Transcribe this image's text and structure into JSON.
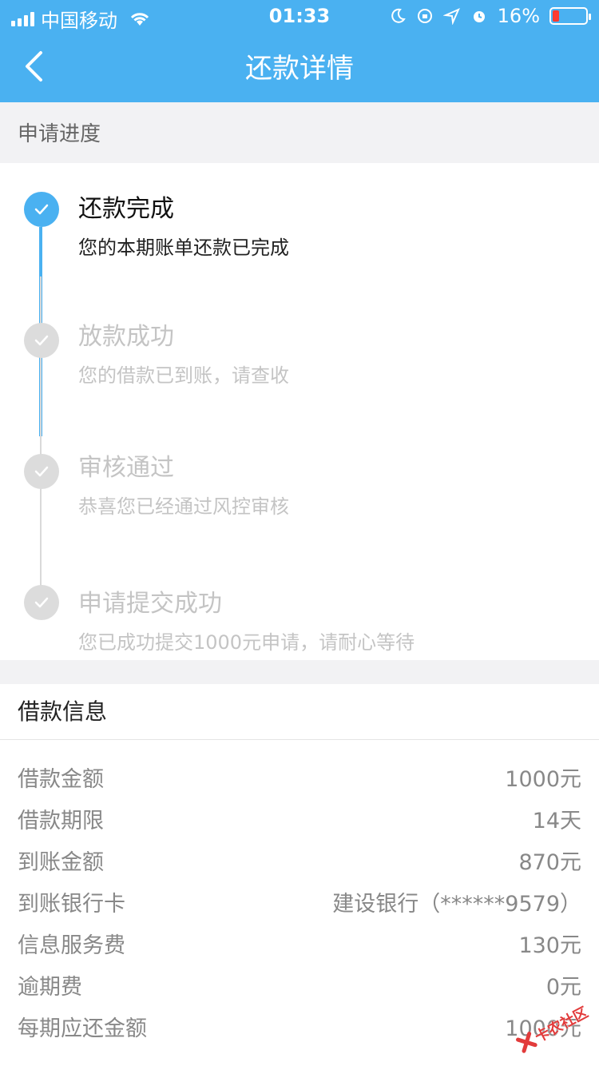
{
  "status_bar": {
    "carrier": "中国移动",
    "time": "01:33",
    "battery_percent": "16%",
    "battery_level": 0.16
  },
  "nav": {
    "title": "还款详情",
    "back_icon": "chevron-left-icon"
  },
  "progress": {
    "section_label": "申请进度",
    "steps": [
      {
        "title": "还款完成",
        "desc": "您的本期账单还款已完成",
        "state": "done"
      },
      {
        "title": "放款成功",
        "desc": "您的借款已到账，请查收",
        "state": "pending"
      },
      {
        "title": "审核通过",
        "desc": "恭喜您已经通过风控审核",
        "state": "pending"
      },
      {
        "title": "申请提交成功",
        "desc": "您已成功提交1000元申请，请耐心等待",
        "state": "pending"
      }
    ]
  },
  "loan_info": {
    "title": "借款信息",
    "rows": [
      {
        "label": "借款金额",
        "value": "1000元"
      },
      {
        "label": "借款期限",
        "value": "14天"
      },
      {
        "label": "到账金额",
        "value": "870元"
      },
      {
        "label": "到账银行卡",
        "value": "建设银行（******9579）"
      },
      {
        "label": "信息服务费",
        "value": "130元"
      },
      {
        "label": "逾期费",
        "value": "0元"
      },
      {
        "label": "每期应还金额",
        "value": "1000元"
      }
    ]
  },
  "watermark": {
    "text": "卡农社区"
  },
  "colors": {
    "accent": "#4ab1f1",
    "inactive": "#dcdcdc",
    "background": "#f2f2f4"
  }
}
